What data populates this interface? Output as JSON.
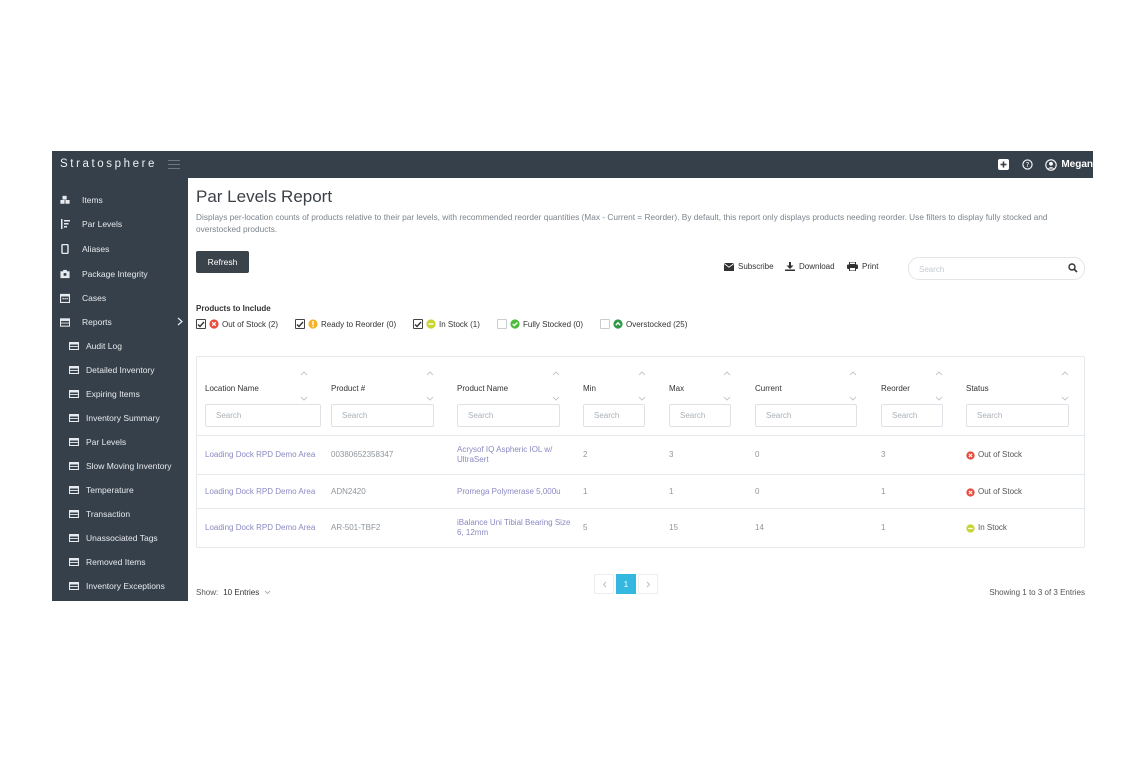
{
  "app": {
    "brand": "Stratosphere",
    "user_name": "Megan"
  },
  "sidebar": {
    "items": [
      {
        "label": "Items",
        "icon": "cubes-icon"
      },
      {
        "label": "Par Levels",
        "icon": "sort-amount-icon"
      },
      {
        "label": "Aliases",
        "icon": "mobile-icon"
      },
      {
        "label": "Package Integrity",
        "icon": "box-icon"
      },
      {
        "label": "Cases",
        "icon": "calendar-icon"
      },
      {
        "label": "Reports",
        "icon": "table-icon"
      }
    ],
    "sub_items": [
      {
        "label": "Audit Log"
      },
      {
        "label": "Detailed Inventory"
      },
      {
        "label": "Expiring Items"
      },
      {
        "label": "Inventory Summary"
      },
      {
        "label": "Par Levels"
      },
      {
        "label": "Slow Moving Inventory"
      },
      {
        "label": "Temperature"
      },
      {
        "label": "Transaction"
      },
      {
        "label": "Unassociated Tags"
      },
      {
        "label": "Removed Items"
      },
      {
        "label": "Inventory Exceptions"
      }
    ]
  },
  "page": {
    "title": "Par Levels Report",
    "description": "Displays per-location counts of products relative to their par levels, with recommended reorder quantities (Max - Current = Reorder). By default, this report only displays products needing reorder. Use filters to display fully stocked and overstocked products.",
    "refresh_label": "Refresh",
    "subscribe_label": "Subscribe",
    "download_label": "Download",
    "print_label": "Print",
    "search_placeholder": "Search"
  },
  "filters": {
    "label": "Products to Include",
    "options": [
      {
        "label": "Out of Stock (2)",
        "checked": true,
        "color": "#e84c3d"
      },
      {
        "label": "Ready to Reorder (0)",
        "checked": true,
        "color": "#f5b225"
      },
      {
        "label": "In Stock (1)",
        "checked": true,
        "color": "#c8d42f"
      },
      {
        "label": "Fully Stocked (0)",
        "checked": false,
        "color": "#4cba3c"
      },
      {
        "label": "Overstocked (25)",
        "checked": false,
        "color": "#2e9a48"
      }
    ]
  },
  "table": {
    "columns": [
      "Location Name",
      "Product #",
      "Product Name",
      "Min",
      "Max",
      "Current",
      "Reorder",
      "Status"
    ],
    "search_placeholder": "Search",
    "rows": [
      {
        "location": "Loading Dock RPD Demo Area",
        "product_no": "00380652358347",
        "product_name_1": "Acrysof IQ Aspheric IOL w/",
        "product_name_2": "UltraSert",
        "min": "2",
        "max": "3",
        "current": "0",
        "reorder": "3",
        "status": "Out of Stock",
        "status_color": "#e84c3d"
      },
      {
        "location": "Loading Dock RPD Demo Area",
        "product_no": "ADN2420",
        "product_name_1": "Promega Polymerase 5,000u",
        "product_name_2": "",
        "min": "1",
        "max": "1",
        "current": "0",
        "reorder": "1",
        "status": "Out of Stock",
        "status_color": "#e84c3d"
      },
      {
        "location": "Loading Dock RPD Demo Area",
        "product_no": "AR-501-TBF2",
        "product_name_1": "iBalance Uni Tibial Bearing Size",
        "product_name_2": "6, 12mm",
        "min": "5",
        "max": "15",
        "current": "14",
        "reorder": "1",
        "status": "In Stock",
        "status_color": "#c8d42f"
      }
    ]
  },
  "footer": {
    "show_label": "Show:",
    "entries_value": "10 Entries",
    "current_page": "1",
    "showing_text": "Showing 1 to 3 of 3 Entries"
  },
  "colors": {
    "sidebar_bg": "#36404a",
    "accent": "#35b8e0",
    "link": "#8a89c3"
  }
}
